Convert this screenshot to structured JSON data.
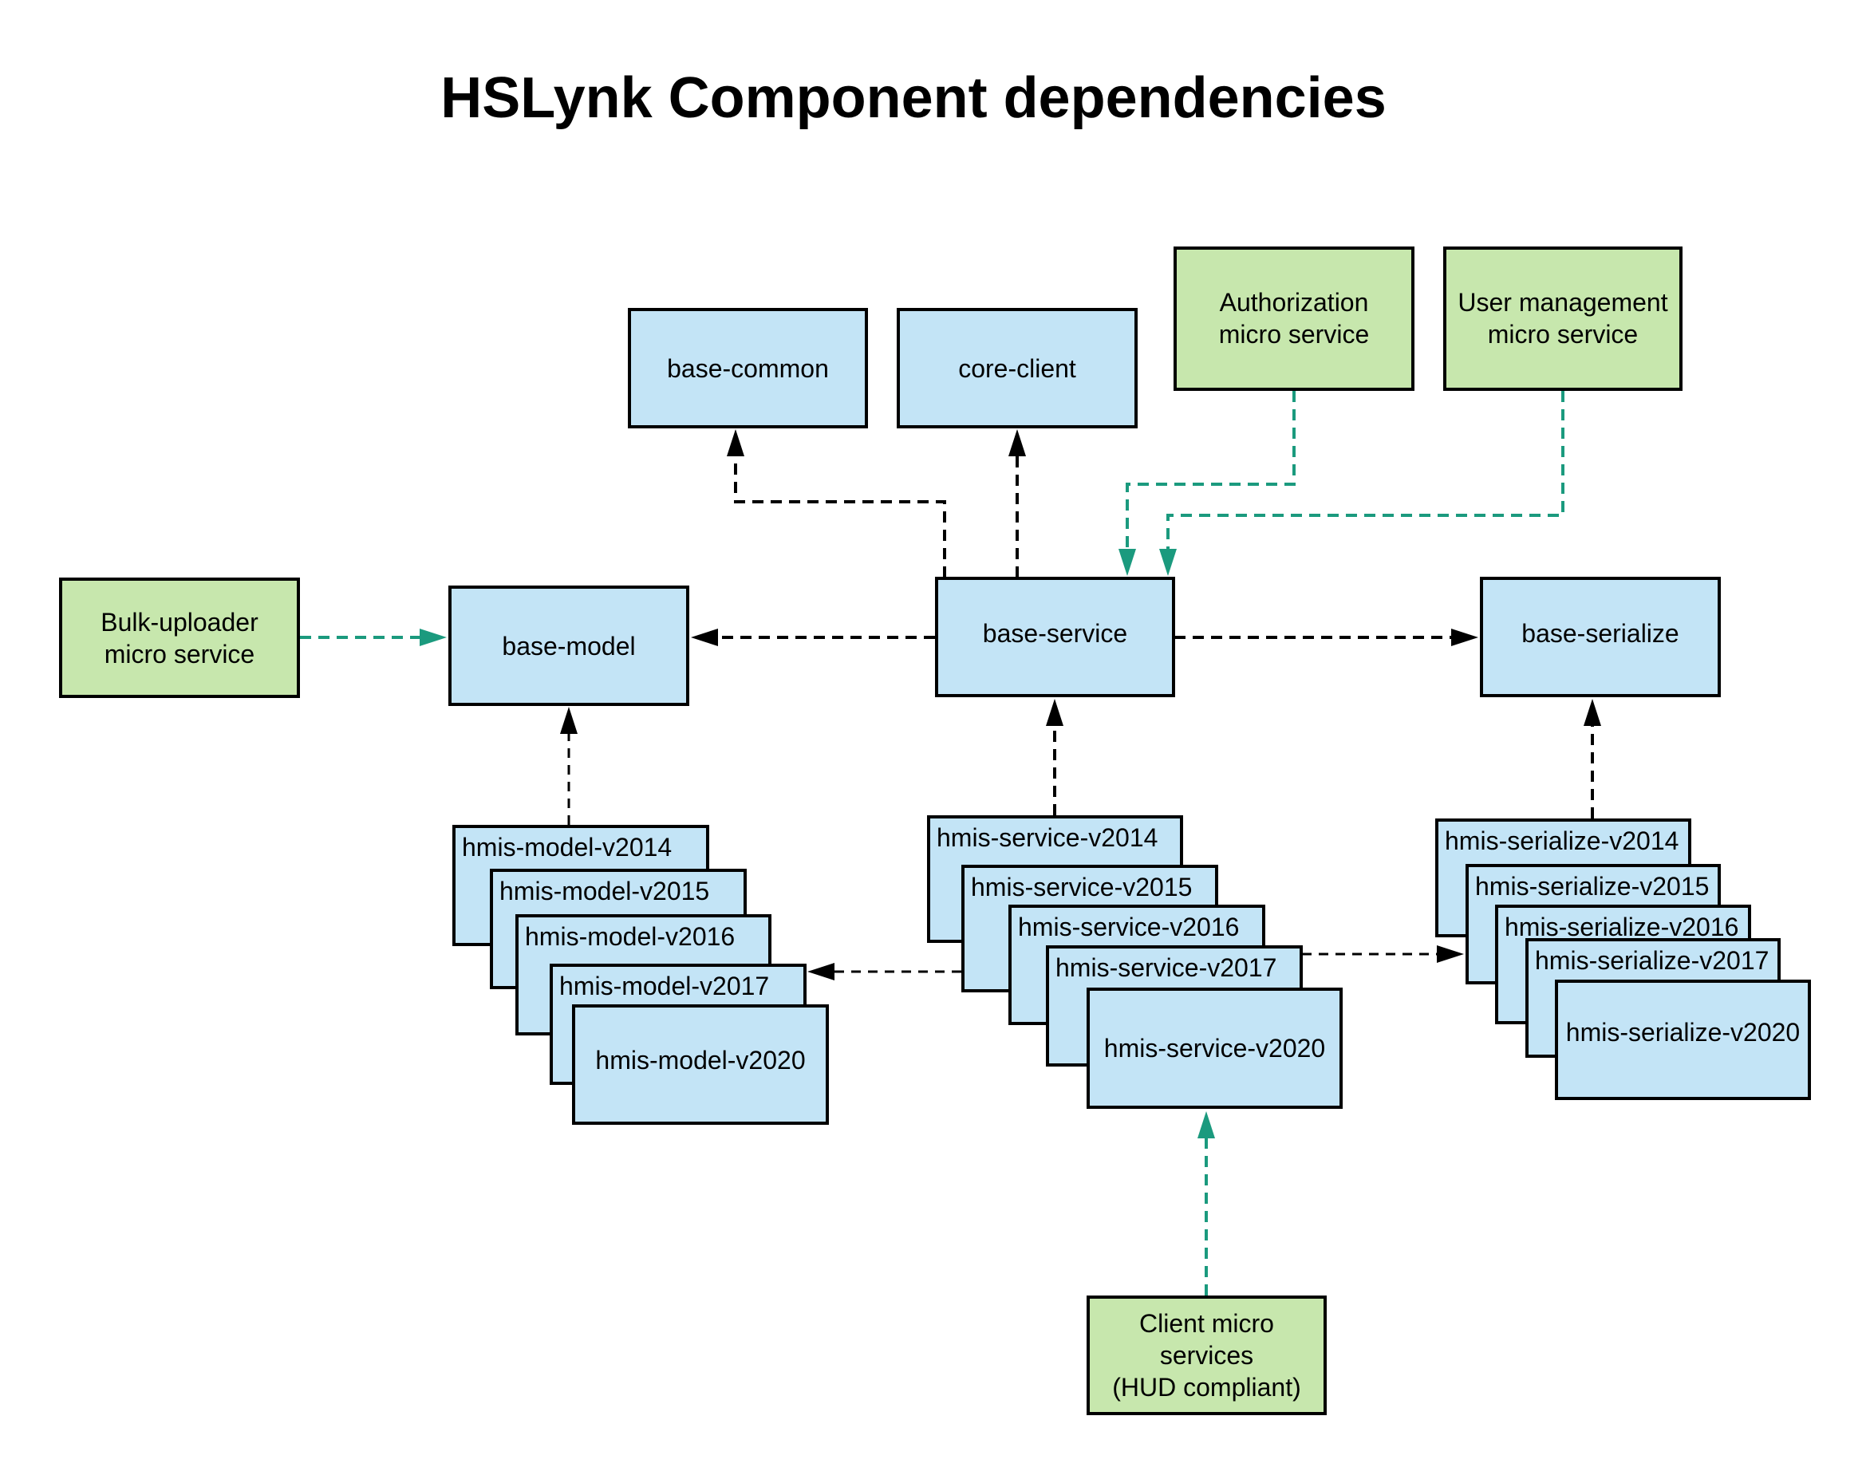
{
  "title": "HSLynk Component dependencies",
  "colors": {
    "core": "#c3e4f6",
    "microservice": "#c7e7ad",
    "dependency_edge": "#000000",
    "consumer_edge": "#1b9a7e"
  },
  "nodes": {
    "base_common": "base-common",
    "core_client": "core-client",
    "authorization": "Authorization\nmicro service",
    "user_management": "User management\nmicro service",
    "bulk_uploader": "Bulk-uploader\nmicro service",
    "base_model": "base-model",
    "base_service": "base-service",
    "base_serialize": "base-serialize",
    "client_micro": "Client micro\nservices\n(HUD compliant)"
  },
  "stacks": {
    "model": [
      "hmis-model-v2014",
      "hmis-model-v2015",
      "hmis-model-v2016",
      "hmis-model-v2017",
      "hmis-model-v2020"
    ],
    "service": [
      "hmis-service-v2014",
      "hmis-service-v2015",
      "hmis-service-v2016",
      "hmis-service-v2017",
      "hmis-service-v2020"
    ],
    "serialize": [
      "hmis-serialize-v2014",
      "hmis-serialize-v2015",
      "hmis-serialize-v2016",
      "hmis-serialize-v2017",
      "hmis-serialize-v2020"
    ]
  },
  "edges": [
    {
      "from": "base-service",
      "to": "base-common",
      "style": "dependency"
    },
    {
      "from": "base-service",
      "to": "core-client",
      "style": "dependency"
    },
    {
      "from": "base-service",
      "to": "base-model",
      "style": "dependency"
    },
    {
      "from": "base-service",
      "to": "base-serialize",
      "style": "dependency"
    },
    {
      "from": "hmis-model",
      "to": "base-model",
      "style": "dependency"
    },
    {
      "from": "hmis-service",
      "to": "base-service",
      "style": "dependency"
    },
    {
      "from": "hmis-serialize",
      "to": "base-serialize",
      "style": "dependency"
    },
    {
      "from": "hmis-service",
      "to": "hmis-model",
      "style": "dependency"
    },
    {
      "from": "hmis-service",
      "to": "hmis-serialize",
      "style": "dependency"
    },
    {
      "from": "Authorization micro service",
      "to": "base-service",
      "style": "consumer"
    },
    {
      "from": "User management micro service",
      "to": "base-service",
      "style": "consumer"
    },
    {
      "from": "Bulk-uploader micro service",
      "to": "base-model",
      "style": "consumer"
    },
    {
      "from": "Client micro services (HUD compliant)",
      "to": "hmis-service-v2020",
      "style": "consumer"
    }
  ]
}
